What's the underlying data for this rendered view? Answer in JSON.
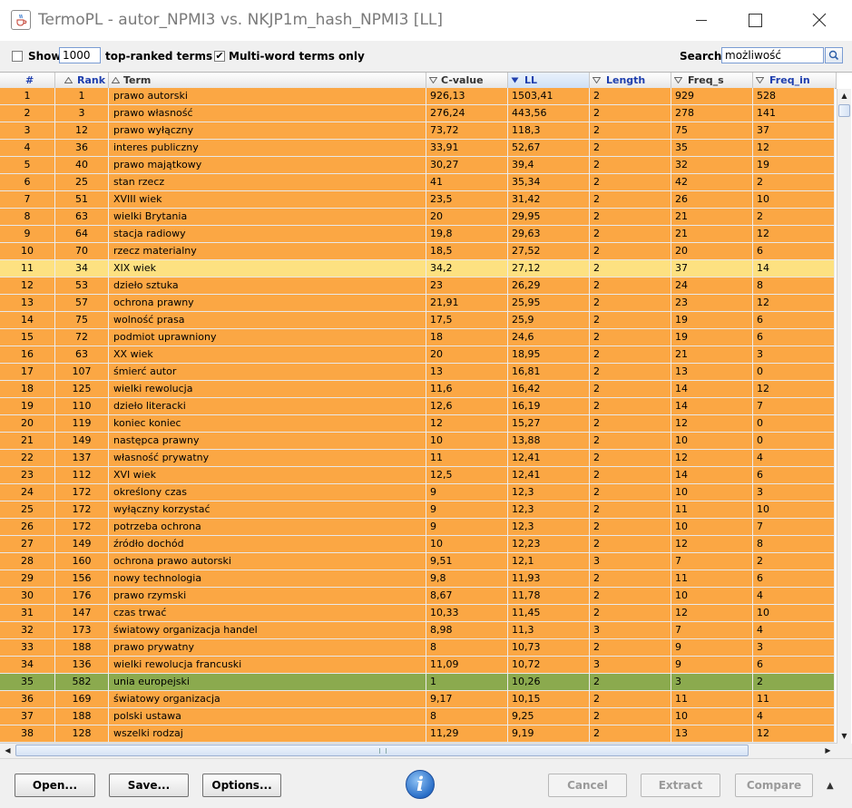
{
  "window": {
    "title": "TermoPL - autor_NPMI3 vs. NKJP1m_hash_NPMI3 [LL]"
  },
  "toolbar": {
    "show_label": "Show",
    "show_value": "1000",
    "top_ranked_label": "top-ranked terms",
    "multiword_label": "Multi-word terms only",
    "multiword_checked": true,
    "search_label": "Search:",
    "search_value": "możliwość"
  },
  "table": {
    "columns": [
      "#",
      "Rank",
      "Term",
      "C-value",
      "LL",
      "Length",
      "Freq_s",
      "Freq_in"
    ],
    "rows": [
      [
        "1",
        "1",
        "prawo autorski",
        "926,13",
        "1503,41",
        "2",
        "929",
        "528"
      ],
      [
        "2",
        "3",
        "prawo własność",
        "276,24",
        "443,56",
        "2",
        "278",
        "141"
      ],
      [
        "3",
        "12",
        "prawo wyłączny",
        "73,72",
        "118,3",
        "2",
        "75",
        "37"
      ],
      [
        "4",
        "36",
        "interes publiczny",
        "33,91",
        "52,67",
        "2",
        "35",
        "12"
      ],
      [
        "5",
        "40",
        "prawo majątkowy",
        "30,27",
        "39,4",
        "2",
        "32",
        "19"
      ],
      [
        "6",
        "25",
        "stan rzecz",
        "41",
        "35,34",
        "2",
        "42",
        "2"
      ],
      [
        "7",
        "51",
        "XVIII wiek",
        "23,5",
        "31,42",
        "2",
        "26",
        "10"
      ],
      [
        "8",
        "63",
        "wielki Brytania",
        "20",
        "29,95",
        "2",
        "21",
        "2"
      ],
      [
        "9",
        "64",
        "stacja radiowy",
        "19,8",
        "29,63",
        "2",
        "21",
        "12"
      ],
      [
        "10",
        "70",
        "rzecz materialny",
        "18,5",
        "27,52",
        "2",
        "20",
        "6"
      ],
      [
        "11",
        "34",
        "XIX wiek",
        "34,2",
        "27,12",
        "2",
        "37",
        "14"
      ],
      [
        "12",
        "53",
        "dzieło sztuka",
        "23",
        "26,29",
        "2",
        "24",
        "8"
      ],
      [
        "13",
        "57",
        "ochrona prawny",
        "21,91",
        "25,95",
        "2",
        "23",
        "12"
      ],
      [
        "14",
        "75",
        "wolność prasa",
        "17,5",
        "25,9",
        "2",
        "19",
        "6"
      ],
      [
        "15",
        "72",
        "podmiot uprawniony",
        "18",
        "24,6",
        "2",
        "19",
        "6"
      ],
      [
        "16",
        "63",
        "XX wiek",
        "20",
        "18,95",
        "2",
        "21",
        "3"
      ],
      [
        "17",
        "107",
        "śmierć autor",
        "13",
        "16,81",
        "2",
        "13",
        "0"
      ],
      [
        "18",
        "125",
        "wielki rewolucja",
        "11,6",
        "16,42",
        "2",
        "14",
        "12"
      ],
      [
        "19",
        "110",
        "dzieło literacki",
        "12,6",
        "16,19",
        "2",
        "14",
        "7"
      ],
      [
        "20",
        "119",
        "koniec koniec",
        "12",
        "15,27",
        "2",
        "12",
        "0"
      ],
      [
        "21",
        "149",
        "następca prawny",
        "10",
        "13,88",
        "2",
        "10",
        "0"
      ],
      [
        "22",
        "137",
        "własność prywatny",
        "11",
        "12,41",
        "2",
        "12",
        "4"
      ],
      [
        "23",
        "112",
        "XVI wiek",
        "12,5",
        "12,41",
        "2",
        "14",
        "6"
      ],
      [
        "24",
        "172",
        "określony czas",
        "9",
        "12,3",
        "2",
        "10",
        "3"
      ],
      [
        "25",
        "172",
        "wyłączny korzystać",
        "9",
        "12,3",
        "2",
        "11",
        "10"
      ],
      [
        "26",
        "172",
        "potrzeba ochrona",
        "9",
        "12,3",
        "2",
        "10",
        "7"
      ],
      [
        "27",
        "149",
        "źródło dochód",
        "10",
        "12,23",
        "2",
        "12",
        "8"
      ],
      [
        "28",
        "160",
        "ochrona prawo autorski",
        "9,51",
        "12,1",
        "3",
        "7",
        "2"
      ],
      [
        "29",
        "156",
        "nowy technologia",
        "9,8",
        "11,93",
        "2",
        "11",
        "6"
      ],
      [
        "30",
        "176",
        "prawo rzymski",
        "8,67",
        "11,78",
        "2",
        "10",
        "4"
      ],
      [
        "31",
        "147",
        "czas trwać",
        "10,33",
        "11,45",
        "2",
        "12",
        "10"
      ],
      [
        "32",
        "173",
        "światowy organizacja handel",
        "8,98",
        "11,3",
        "3",
        "7",
        "4"
      ],
      [
        "33",
        "188",
        "prawo prywatny",
        "8",
        "10,73",
        "2",
        "9",
        "3"
      ],
      [
        "34",
        "136",
        "wielki rewolucja francuski",
        "11,09",
        "10,72",
        "3",
        "9",
        "6"
      ],
      [
        "35",
        "582",
        "unia europejski",
        "1",
        "10,26",
        "2",
        "3",
        "2"
      ],
      [
        "36",
        "169",
        "światowy organizacja",
        "9,17",
        "10,15",
        "2",
        "11",
        "11"
      ],
      [
        "37",
        "188",
        "polski ustawa",
        "8",
        "9,25",
        "2",
        "10",
        "4"
      ],
      [
        "38",
        "128",
        "wszelki rodzaj",
        "11,29",
        "9,19",
        "2",
        "13",
        "12"
      ]
    ],
    "highlighted_row": 11,
    "green_row": 35,
    "colors": {
      "row": "#fba744",
      "highlight": "#fde181",
      "green": "#8baa4e",
      "header_text": "#1f3fae"
    }
  },
  "buttons": {
    "open": "Open...",
    "save": "Save...",
    "options": "Options...",
    "cancel": "Cancel",
    "extract": "Extract",
    "compare": "Compare"
  },
  "icons": {
    "app": "java-cup-icon",
    "info": "info-icon",
    "search": "magnifier-icon"
  }
}
